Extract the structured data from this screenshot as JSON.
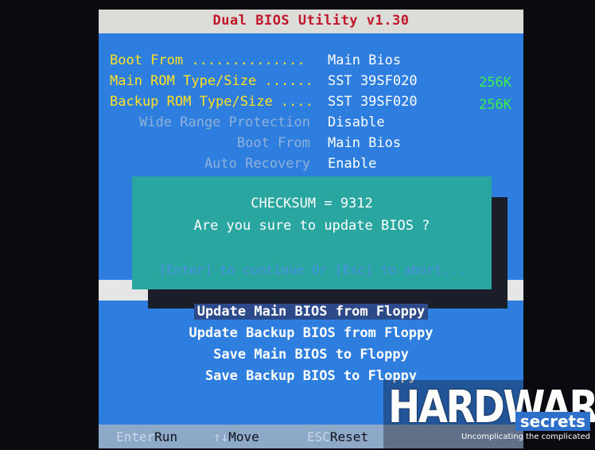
{
  "title": "Dual BIOS Utility v1.30",
  "settings": [
    {
      "label": "Boot From ..............",
      "value": "Main Bios",
      "size": ""
    },
    {
      "label": "Main ROM Type/Size ......",
      "value": "SST 39SF020",
      "size": "256K"
    },
    {
      "label": "Backup ROM Type/Size ....",
      "value": "SST 39SF020",
      "size": "256K"
    },
    {
      "label": "Wide Range Protection",
      "value": "Disable",
      "size": ""
    },
    {
      "label": "Boot From",
      "value": "Main Bios",
      "size": ""
    },
    {
      "label": "Auto Recovery",
      "value": "Enable",
      "size": ""
    }
  ],
  "dialog": {
    "checksum": "CHECKSUM = 9312",
    "question": "Are you sure to update BIOS ?",
    "hint": "[Enter] to continue Or [Esc] to abort..."
  },
  "menu": [
    "Update Main BIOS from Floppy",
    "Update Backup BIOS from Floppy",
    "Save Main BIOS to Floppy",
    "Save Backup BIOS to Floppy"
  ],
  "footer": [
    {
      "key": "Enter",
      "action": "Run"
    },
    {
      "key": "↑↓",
      "action": "Move"
    },
    {
      "key": "ESC",
      "action": "Reset"
    }
  ],
  "watermark": {
    "word": "HARDWARE",
    "secrets": "secrets",
    "tagline": "Uncomplicating the complicated"
  },
  "colors": {
    "background": "#2e7ee0",
    "title_bar": "#dcdcd8",
    "title_text": "#c0182a",
    "label_yellow": "#ffe024",
    "size_green": "#3cf04a",
    "dialog": "#2aa6a0",
    "selected": "#2c4a8a",
    "footer": "#8ea8c8"
  }
}
